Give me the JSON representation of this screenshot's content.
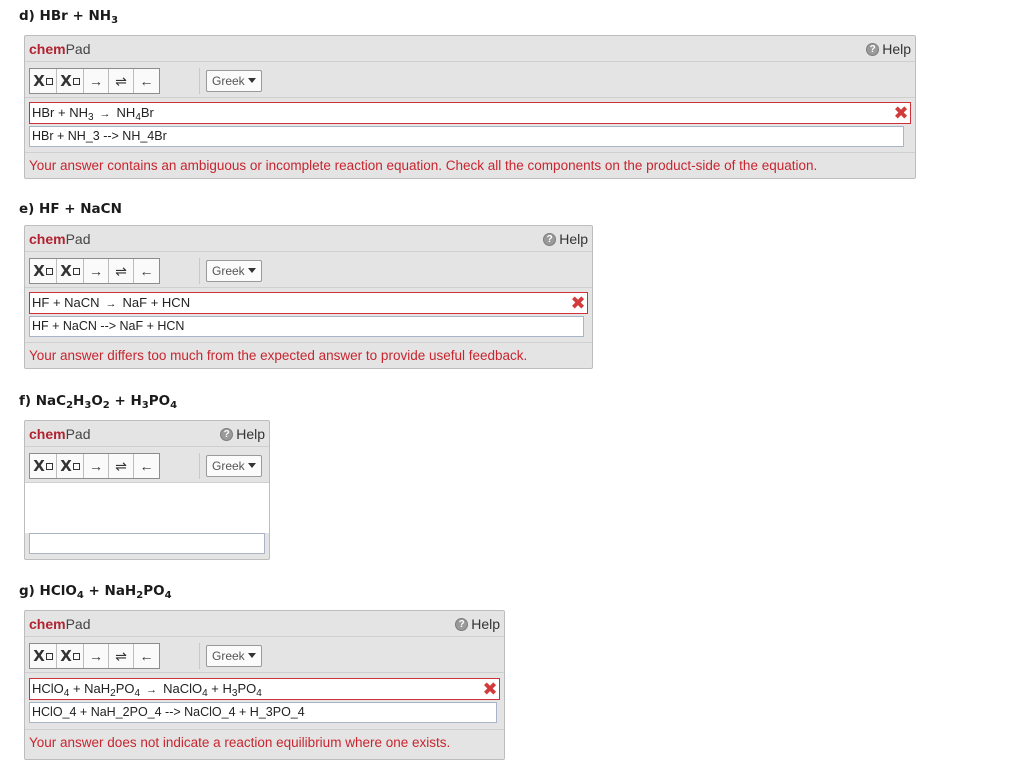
{
  "common": {
    "brand_chem": "chem",
    "brand_pad": "Pad",
    "help_label": "Help",
    "help_glyph": "?",
    "greek_label": "Greek",
    "tools": [
      "Xsub",
      "Xsup",
      "→",
      "⇌",
      "←"
    ],
    "arrow": "→",
    "wrong_mark": "✖"
  },
  "questions": [
    {
      "id": "d",
      "title": [
        "d) HBr + NH",
        "3",
        ""
      ],
      "preview": [
        "HBr + NH",
        "3",
        "",
        "NH",
        "4",
        "Br"
      ],
      "raw_value": "HBr + NH_3 --> NH_4Br",
      "feedback": "Your answer contains an ambiguous or incomplete reaction equation. Check all the components on the product-side of the equation."
    },
    {
      "id": "e",
      "title": [
        "e) HF + NaCN"
      ],
      "preview_text": "HF + NaCN",
      "preview_product": "NaF + HCN",
      "raw_value": "HF + NaCN --> NaF + HCN",
      "feedback": "Your answer differs too much from the expected answer to provide useful feedback."
    },
    {
      "id": "f",
      "title": [
        "f) NaC",
        "2",
        "H",
        "3",
        "O",
        "2",
        " + H",
        "3",
        "PO",
        "4"
      ],
      "raw_value": ""
    },
    {
      "id": "g",
      "title": [
        "g) HClO",
        "4",
        " + NaH",
        "2",
        "PO",
        "4"
      ],
      "preview": [
        "HClO",
        "4",
        " + NaH",
        "2",
        "PO",
        "4",
        "NaClO",
        "4",
        " + H",
        "3",
        "PO",
        "4"
      ],
      "raw_value": "HClO_4 + NaH_2PO_4 --> NaClO_4 + H_3PO_4",
      "feedback": "Your answer does not indicate a reaction equilibrium where one exists."
    }
  ]
}
